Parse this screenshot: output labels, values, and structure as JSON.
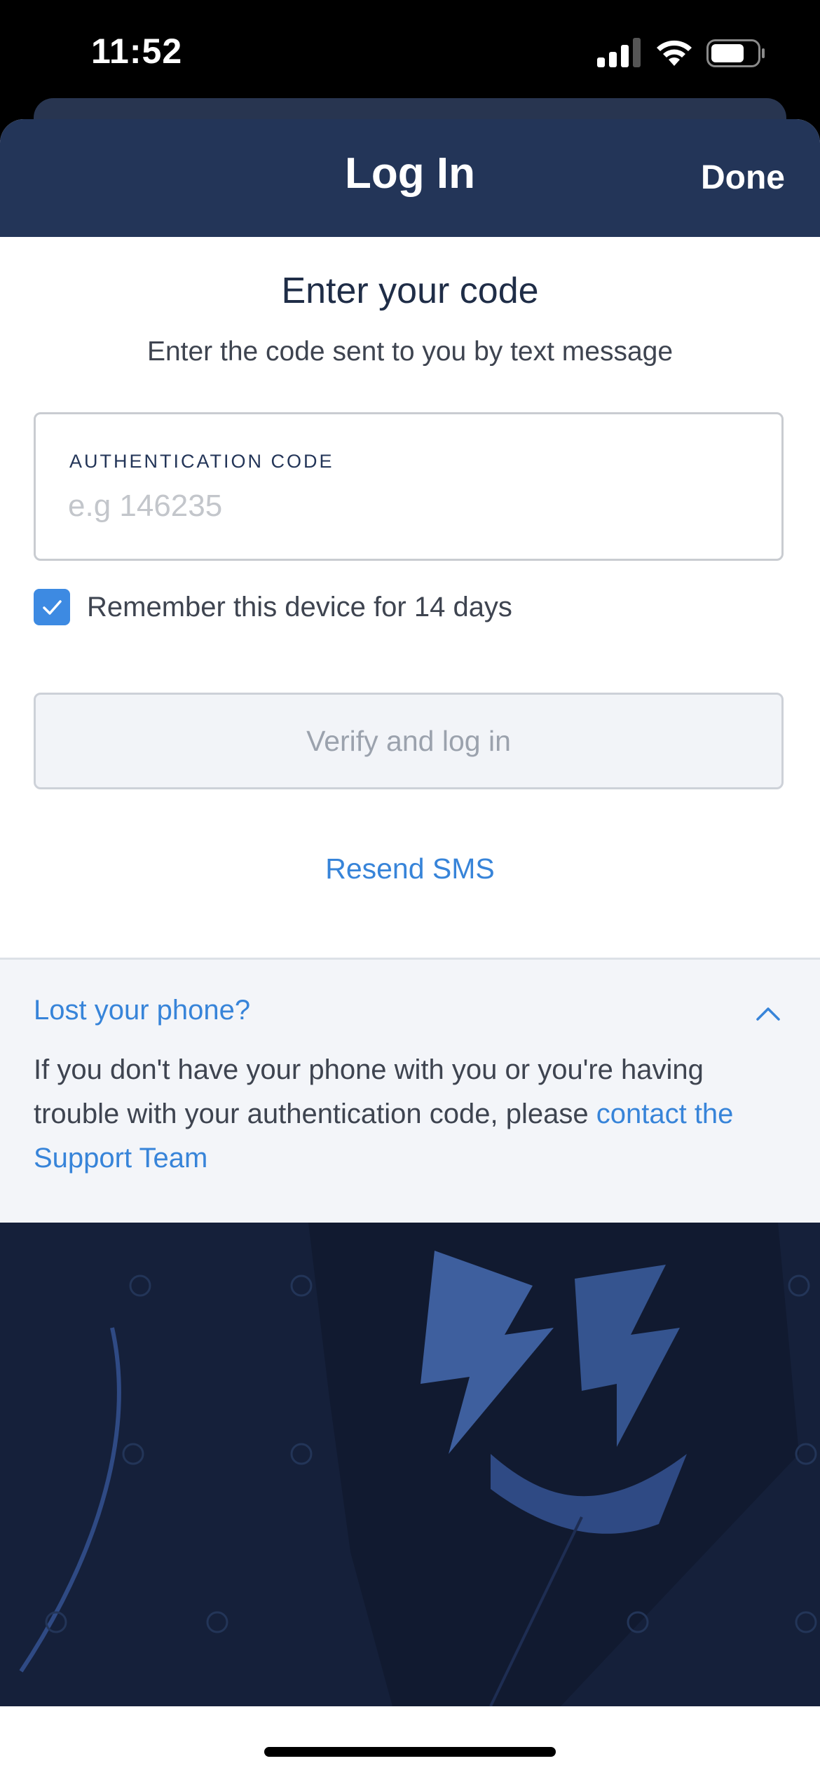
{
  "status_bar": {
    "time": "11:52"
  },
  "nav": {
    "title": "Log In",
    "done_label": "Done"
  },
  "main": {
    "heading": "Enter your code",
    "subheading": "Enter the code sent to you by text message",
    "code_field": {
      "label": "AUTHENTICATION CODE",
      "value": "",
      "placeholder": "e.g 146235"
    },
    "remember": {
      "label": "Remember this device for 14 days",
      "checked": true
    },
    "verify_label": "Verify and log in",
    "resend_label": "Resend SMS"
  },
  "lost_phone": {
    "title": "Lost your phone?",
    "body_text": "If you don't have your phone with you or you're having trouble with your authentication code, please ",
    "link_text": "contact the Support Team",
    "expanded": true
  },
  "colors": {
    "nav_background": "#233558",
    "accent_blue": "#3784d9",
    "checkbox_blue": "#3d8ae2",
    "panel_background": "#f3f5f9",
    "hero_background": "#15203a"
  },
  "icons": [
    "signal-icon",
    "wifi-icon",
    "battery-icon",
    "checkmark-icon",
    "chevron-up-icon"
  ]
}
